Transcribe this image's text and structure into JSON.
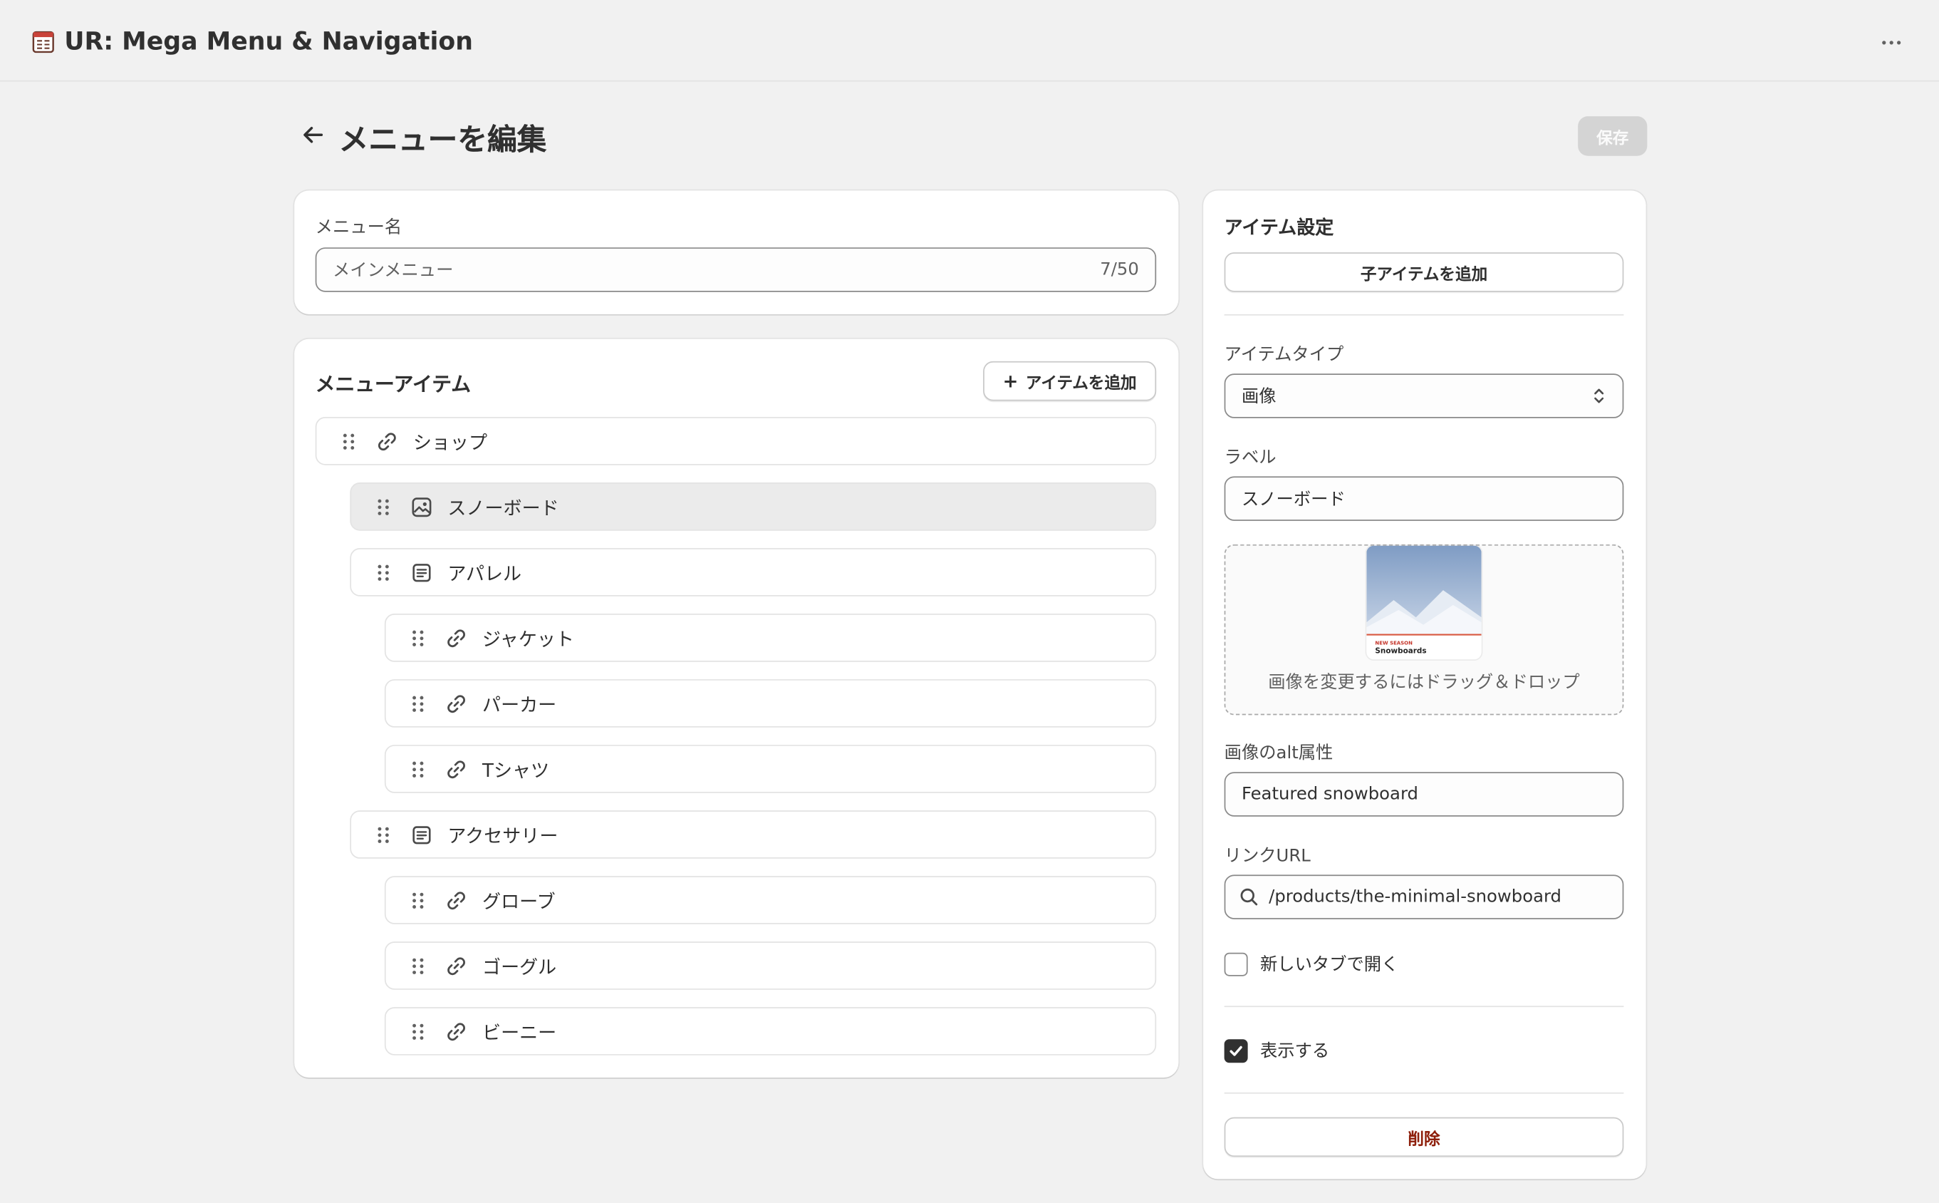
{
  "app": {
    "title": "UR: Mega Menu & Navigation"
  },
  "page": {
    "title": "メニューを編集",
    "save_label": "保存"
  },
  "menu_name": {
    "label": "メニュー名",
    "value": "メインメニュー",
    "counter": "7/50"
  },
  "menu_items": {
    "title": "メニューアイテム",
    "add_label": "アイテムを追加",
    "rows": [
      {
        "label": "ショップ",
        "icon": "link-icon",
        "depth": 0,
        "selected": false
      },
      {
        "label": "スノーボード",
        "icon": "image-icon",
        "depth": 1,
        "selected": true
      },
      {
        "label": "アパレル",
        "icon": "collection-icon",
        "depth": 1,
        "selected": false
      },
      {
        "label": "ジャケット",
        "icon": "link-icon",
        "depth": 2,
        "selected": false
      },
      {
        "label": "パーカー",
        "icon": "link-icon",
        "depth": 2,
        "selected": false
      },
      {
        "label": "Tシャツ",
        "icon": "link-icon",
        "depth": 2,
        "selected": false
      },
      {
        "label": "アクセサリー",
        "icon": "collection-icon",
        "depth": 1,
        "selected": false
      },
      {
        "label": "グローブ",
        "icon": "link-icon",
        "depth": 2,
        "selected": false
      },
      {
        "label": "ゴーグル",
        "icon": "link-icon",
        "depth": 2,
        "selected": false
      },
      {
        "label": "ビーニー",
        "icon": "link-icon",
        "depth": 2,
        "selected": false
      }
    ]
  },
  "settings": {
    "title": "アイテム設定",
    "add_child_label": "子アイテムを追加",
    "item_type_label": "アイテムタイプ",
    "item_type_value": "画像",
    "label_label": "ラベル",
    "label_value": "スノーボード",
    "image": {
      "badge": "NEW SEASON",
      "caption": "Snowboards",
      "drop_hint": "画像を変更するにはドラッグ＆ドロップ"
    },
    "alt_label": "画像のalt属性",
    "alt_value": "Featured snowboard",
    "url_label": "リンクURL",
    "url_value": "/products/the-minimal-snowboard",
    "new_tab_label": "新しいタブで開く",
    "new_tab_checked": false,
    "visible_label": "表示する",
    "visible_checked": true,
    "delete_label": "削除"
  },
  "colors": {
    "background": "#f1f1f1",
    "card": "#ffffff",
    "selected_row": "#ebebeb",
    "danger": "#8e1f0b",
    "disabled_button": "#d4d4d4"
  }
}
